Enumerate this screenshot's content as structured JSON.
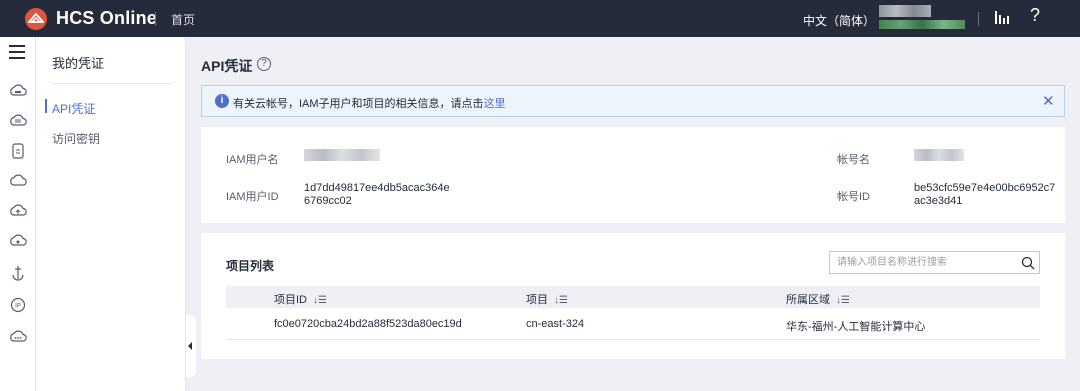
{
  "topbar": {
    "brand": "HCS Online",
    "home": "首页",
    "language": "中文（简体）",
    "help_symbol": "?"
  },
  "sidebar": {
    "title": "我的凭证",
    "items": [
      {
        "label": "API凭证",
        "active": true
      },
      {
        "label": "访问密钥",
        "active": false
      }
    ]
  },
  "page": {
    "title": "API凭证",
    "help_symbol": "?"
  },
  "notice": {
    "text": "有关云帐号，IAM子用户和项目的相关信息，请点击",
    "link": "这里",
    "close": "✕"
  },
  "credentials": {
    "iam_username_label": "IAM用户名",
    "iam_user_id_label": "IAM用户ID",
    "iam_user_id_line1": "1d7dd49817ee4db5acac364e",
    "iam_user_id_line2": "6769cc02",
    "account_name_label": "帐号名",
    "account_id_label": "帐号ID",
    "account_id_line1": "be53cfc59e7e4e00bc6952c7",
    "account_id_line2": "ac3e3d41"
  },
  "projects": {
    "title": "项目列表",
    "search_placeholder": "请输入项目名称进行搜索",
    "columns": [
      "项目ID",
      "项目",
      "所属区域"
    ],
    "sort_symbol": "↓☰",
    "rows": [
      {
        "project_id": "fc0e0720cba24bd2a88f523da80ec19d",
        "project": "cn-east-324",
        "region": "华东-福州-人工智能计算中心"
      }
    ]
  },
  "colors": {
    "topbar_bg": "#252b3a",
    "accent": "#526ecc",
    "notice_bg": "#eef4fc"
  }
}
